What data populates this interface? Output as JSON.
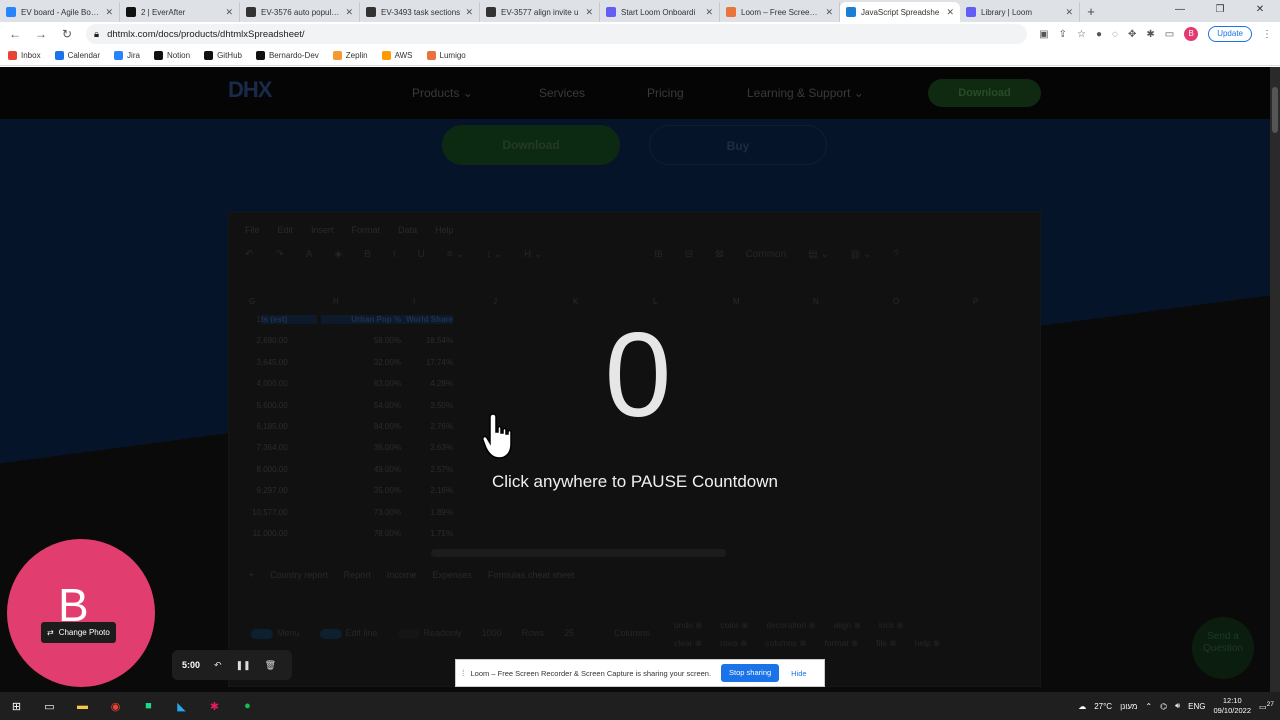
{
  "browser": {
    "tabs": [
      {
        "title": "EV board - Agile Board",
        "color": "#2684ff",
        "active": false
      },
      {
        "title": "2 | EverAfter",
        "color": "#111111",
        "active": false
      },
      {
        "title": "EV-3576 auto populate",
        "color": "#333333",
        "active": false
      },
      {
        "title": "EV-3493 task sections",
        "color": "#333333",
        "active": false
      },
      {
        "title": "EV-3577 align invite u",
        "color": "#333333",
        "active": false
      },
      {
        "title": "Start Loom Onboardi",
        "color": "#625df5",
        "active": false
      },
      {
        "title": "Loom – Free Screen R",
        "color": "#e8743b",
        "active": false
      },
      {
        "title": "JavaScript Spreadshe",
        "color": "#1c7fd6",
        "active": true
      },
      {
        "title": "Library | Loom",
        "color": "#625df5",
        "active": false
      }
    ],
    "new_tab": "+",
    "url": "dhtmlx.com/docs/products/dhtmlxSpreadsheet/",
    "avatar_letter": "B",
    "update_label": "Update",
    "bookmarks": [
      {
        "label": "Inbox",
        "color": "#ea4335"
      },
      {
        "label": "Calendar",
        "color": "#1a73e8"
      },
      {
        "label": "Jira",
        "color": "#2684ff"
      },
      {
        "label": "Notion",
        "color": "#111111"
      },
      {
        "label": "GitHub",
        "color": "#111111"
      },
      {
        "label": "Bernardo-Dev",
        "color": "#111111"
      },
      {
        "label": "Zeplin",
        "color": "#f69833"
      },
      {
        "label": "AWS",
        "color": "#ff9900"
      },
      {
        "label": "Lumigo",
        "color": "#e8743b"
      }
    ]
  },
  "site": {
    "logo": "DHX",
    "menu": [
      "Products",
      "Services",
      "Pricing",
      "Learning & Support"
    ],
    "download_label": "Download",
    "hero_download": "Download",
    "hero_buy": "Buy"
  },
  "spreadsheet": {
    "menu": [
      "File",
      "Edit",
      "Insert",
      "Format",
      "Data",
      "Help"
    ],
    "format_select": "Common",
    "columns": [
      "G",
      "H",
      "I",
      "J",
      "K",
      "L",
      "M",
      "N",
      "O",
      "P"
    ],
    "header": [
      "ts (est)",
      "Urban Pop %",
      "World Share"
    ],
    "rows": [
      {
        "n": "1",
        "a": "ts (est)",
        "b": "Urban Pop %",
        "c": "World Share"
      },
      {
        "n": "2",
        "a": ",690.00",
        "b": "58.00%",
        "c": "18.54%"
      },
      {
        "n": "3",
        "a": ",645.00",
        "b": "32.00%",
        "c": "17.74%"
      },
      {
        "n": "4",
        "a": ",000.00",
        "b": "83.00%",
        "c": "4.28%"
      },
      {
        "n": "5",
        "a": ",600.00",
        "b": "54.00%",
        "c": "3.50%"
      },
      {
        "n": "6",
        "a": ",185.00",
        "b": "84.00%",
        "c": "2.76%"
      },
      {
        "n": "7",
        "a": ",364.00",
        "b": "36.00%",
        "c": "2.63%"
      },
      {
        "n": "8",
        "a": ",000.00",
        "b": "49.00%",
        "c": "2.57%"
      },
      {
        "n": "9",
        "a": ",297.00",
        "b": "35.00%",
        "c": "2.16%"
      },
      {
        "n": "10",
        "a": ",577.00",
        "b": "73.00%",
        "c": "1.89%"
      },
      {
        "n": "11",
        "a": ",000.00",
        "b": "78.00%",
        "c": "1.71%"
      }
    ],
    "sheets": [
      "+",
      "Country report",
      "Report",
      "Income",
      "Expenses",
      "Formulas cheat sheet"
    ],
    "footer": {
      "menu": "Menu",
      "edit_line": "Edit line",
      "readonly": "Readonly",
      "rows_value": "1000",
      "rows_label": "Rows",
      "cols_value": "25",
      "cols_label": "Columns"
    },
    "chips_row1": [
      "undo",
      "color",
      "decoration",
      "align",
      "lock"
    ],
    "chips_row2": [
      "clear",
      "rows",
      "columns",
      "format",
      "file",
      "help"
    ]
  },
  "send_question": "Send a Question",
  "countdown": {
    "number": "0",
    "message": "Click anywhere to PAUSE Countdown"
  },
  "loom": {
    "bubble_letter": "B",
    "change_photo": "Change Photo",
    "timer": "5:00",
    "share_text": "Loom – Free Screen Recorder & Screen Capture is sharing your screen.",
    "stop_sharing": "Stop sharing",
    "hide": "Hide"
  },
  "taskbar": {
    "weather": "27°C",
    "weather_text": "מעונן",
    "lang": "ENG",
    "time": "12:10",
    "date": "09/10/2022",
    "notifications": "27"
  }
}
